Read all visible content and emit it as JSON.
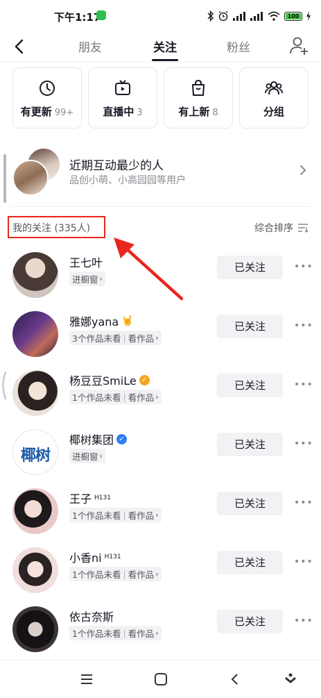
{
  "status_bar": {
    "time": "下午1:17",
    "battery": "100"
  },
  "tabs": [
    {
      "label": "朋友",
      "active": false
    },
    {
      "label": "关注",
      "active": true
    },
    {
      "label": "粉丝",
      "active": false
    }
  ],
  "quick_filters": [
    {
      "label": "有更新",
      "count": "99+",
      "icon": "clock-icon"
    },
    {
      "label": "直播中",
      "count": "3",
      "icon": "tv-icon"
    },
    {
      "label": "有上新",
      "count": "8",
      "icon": "shopping-bag-icon"
    },
    {
      "label": "分组",
      "count": "",
      "icon": "group-icon"
    }
  ],
  "least_interaction": {
    "title": "近期互动最少的人",
    "subtitle": "品创小萌、小高园园等用户"
  },
  "section": {
    "title": "我的关注 (335人)",
    "sort_label": "综合排序"
  },
  "follow_list": [
    {
      "name": "王七叶",
      "superscript": "",
      "badge": "",
      "tag_parts": [
        "进橱窗"
      ],
      "button": "已关注"
    },
    {
      "name": "雅娜yana",
      "superscript": "",
      "badge": "🤘",
      "tag_parts": [
        "3个作品未看",
        "看作品"
      ],
      "button": "已关注"
    },
    {
      "name": "杨豆豆SmiLe",
      "superscript": "",
      "badge": "verified-orange",
      "tag_parts": [
        "1个作品未看",
        "看作品"
      ],
      "button": "已关注"
    },
    {
      "name": "椰树集团",
      "superscript": "",
      "badge": "verified-blue",
      "tag_parts": [
        "进橱窗"
      ],
      "button": "已关注",
      "logo_text": "椰树"
    },
    {
      "name": "王子",
      "superscript": "H131",
      "badge": "",
      "tag_parts": [
        "1个作品未看",
        "看作品"
      ],
      "button": "已关注"
    },
    {
      "name": "小香ni",
      "superscript": "H131",
      "badge": "",
      "tag_parts": [
        "1个作品未看",
        "看作品"
      ],
      "button": "已关注"
    },
    {
      "name": "依古奈斯",
      "superscript": "",
      "badge": "",
      "tag_parts": [
        "1个作品未看",
        "看作品"
      ],
      "button": "已关注"
    }
  ],
  "colors": {
    "accent": "#e8261d",
    "verified_orange": "#f5a623",
    "verified_blue": "#2c7ff5",
    "button_bg": "#f2f2f4"
  }
}
